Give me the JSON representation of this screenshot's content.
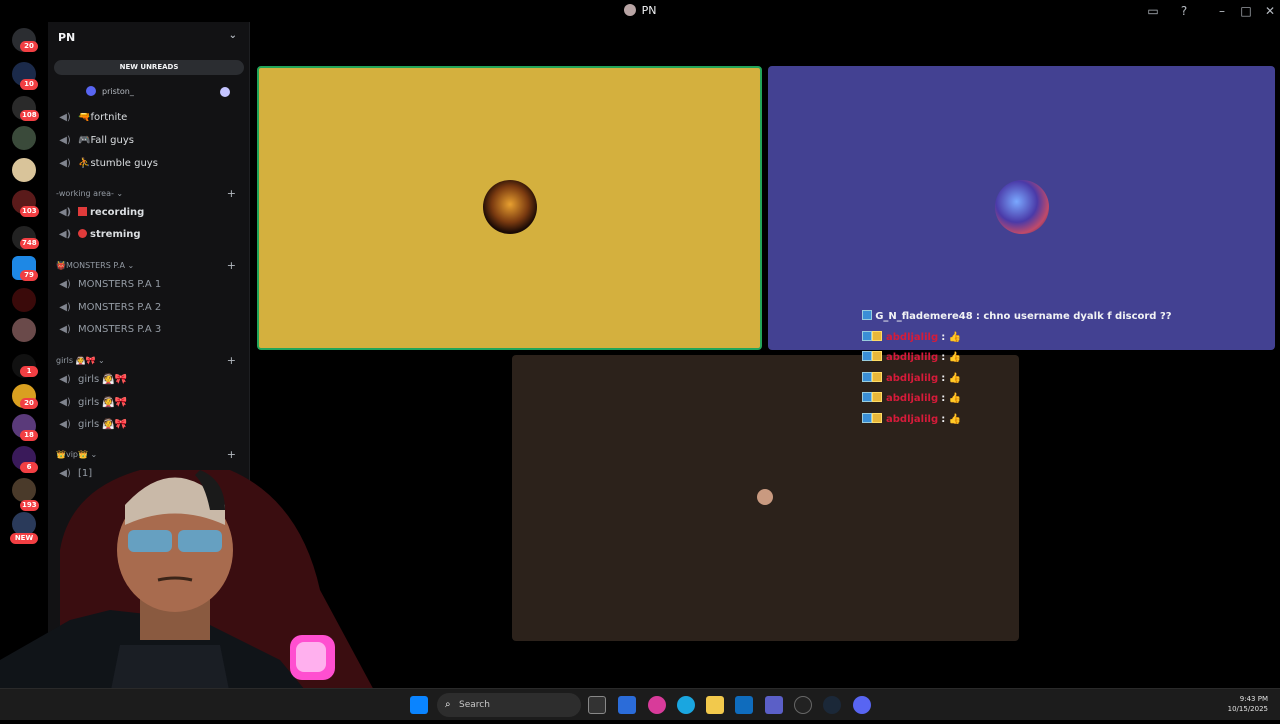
{
  "window": {
    "title": "PN"
  },
  "server": {
    "name": "PN",
    "new_unreads_label": "NEW UNREADS"
  },
  "guild_badges": [
    "20",
    "10",
    "108",
    "103",
    "748",
    "79",
    "1",
    "20",
    "18",
    "6",
    "193",
    "NEW"
  ],
  "channels": {
    "member_priston": "priston_",
    "fortnite": "fortnite",
    "fall_guys": "Fall guys",
    "stumble_guys": "stumble guys",
    "cat_working": "-working area-",
    "recording": "recording",
    "streming": "streming",
    "cat_monsters": "MONSTERS P.A",
    "monsters1": "MONSTERS P.A 1",
    "monsters2": "MONSTERS P.A 2",
    "monsters3": "MONSTERS P.A 3",
    "cat_girls": "girls",
    "girls1": "girls",
    "girls2": "girls",
    "girls3": "girls",
    "cat_vip": "vip",
    "vip_partial": "[1]",
    "user_tag": "PN"
  },
  "chat": [
    {
      "user": "G_N_flademere48",
      "text": ": chno username dyalk f discord ??",
      "color": "white"
    },
    {
      "user": "abdljalilg",
      "text": ": 👍",
      "color": "red"
    },
    {
      "user": "abdljalilg",
      "text": ": 👍",
      "color": "red"
    },
    {
      "user": "abdljalilg",
      "text": ": 👍",
      "color": "red"
    },
    {
      "user": "abdljalilg",
      "text": ": 👍",
      "color": "red"
    },
    {
      "user": "abdljalilg",
      "text": ": 👍",
      "color": "red"
    }
  ],
  "taskbar": {
    "search_placeholder": "Search",
    "time": "9:43 PM",
    "date": "10/15/2025"
  },
  "colors": {
    "tile1": "#d4b03e",
    "tile2": "#434192",
    "tile3": "#2c221b",
    "speaking_border": "#23a55a",
    "badge": "#f23f43"
  },
  "icons": [
    "windows-icon",
    "search-icon",
    "file-explorer-icon",
    "edge-icon",
    "outlook-icon",
    "teams-icon",
    "steam-icon",
    "discord-icon"
  ]
}
